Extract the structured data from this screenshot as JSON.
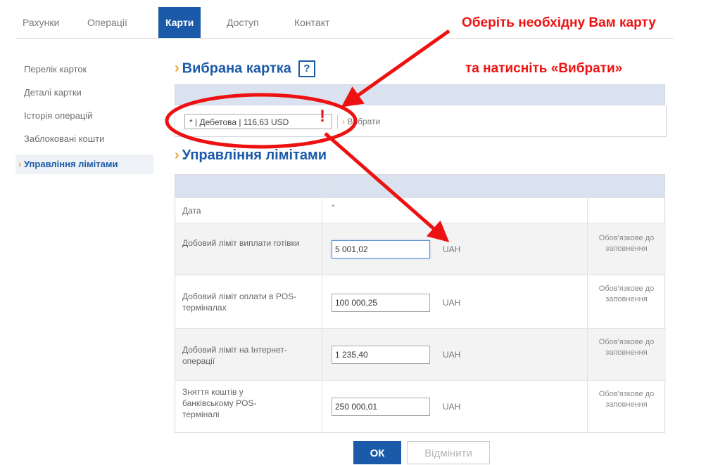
{
  "nav": {
    "tabs": [
      {
        "label": "Рахунки"
      },
      {
        "label": "Операції"
      },
      {
        "label": "Карти",
        "active": true
      },
      {
        "label": "Доступ"
      },
      {
        "label": "Контакт"
      }
    ]
  },
  "sidebar": {
    "items": [
      {
        "label": "Перелік карток"
      },
      {
        "label": "Деталі картки"
      },
      {
        "label": "Історія операцій"
      },
      {
        "label": "Заблоковані кошти"
      },
      {
        "label": "Управління лімітами",
        "active": true
      }
    ]
  },
  "selected_card": {
    "title": "Вибрана картка",
    "help_label": "?",
    "select_value": "*       | Дебетова | 116,63 USD",
    "choose_label": "Вибрати"
  },
  "limits": {
    "title": "Управління лімітами",
    "date_label": "Дата",
    "date_value": "*",
    "rows": [
      {
        "label": "Добовий ліміт виплати готівки",
        "value": "5 001,02",
        "currency": "UAH",
        "required": "Обов'язкове до заповнення"
      },
      {
        "label": "Добовий ліміт оплати в POS-терміналах",
        "value": "100 000,25",
        "currency": "UAH",
        "required": "Обов'язкове до заповнення"
      },
      {
        "label": "Добовий ліміт на Інтернет-операції",
        "value": "1 235,40",
        "currency": "UAH",
        "required": "Обов'язкове до заповнення"
      },
      {
        "label": "Зняття коштів у банківському POS-терміналі",
        "value": "250 000,01",
        "currency": "UAH",
        "required": "Обов'язкове до заповнення"
      }
    ]
  },
  "actions": {
    "ok_label": "ОК",
    "cancel_label": "Відмінити"
  },
  "annotation": {
    "line1": "Оберіть необхідну Вам карту",
    "line2": "та натисніть «Вибрати»",
    "exclamation": "!",
    "color": "#ee1111"
  },
  "colors": {
    "brand": "#1a5aa8",
    "accent": "#f0a030",
    "panel": "#d9e2ee"
  }
}
